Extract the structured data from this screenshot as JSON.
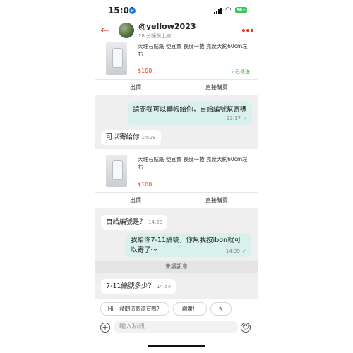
{
  "status_bar": {
    "time": "15:00",
    "battery": "86+"
  },
  "header": {
    "back": "←",
    "username": "@yellow2023",
    "last_seen": "28 分鐘前上線",
    "more": "⋯"
  },
  "product_card_1": {
    "title": "大理石貼紙 便宜賣 長度一捲 寬度大約60cm左右",
    "price": "$100",
    "status": "✓已傳送"
  },
  "card_actions_1": {
    "offer": "出價",
    "buy": "直接購買"
  },
  "messages": [
    {
      "text": "請問我可以轉帳給你，自給編號幫寄嗎",
      "time": "13:17",
      "check": "✓"
    },
    {
      "text": "可以寄給你",
      "time": "14:29"
    }
  ],
  "product_card_2": {
    "title": "大理石貼紙 便宜賣 長度一捲 寬度大約60cm左右",
    "price": "$100"
  },
  "card_actions_2": {
    "offer": "出價",
    "buy": "直接購買"
  },
  "messages_2": [
    {
      "text": "自給編號是？",
      "time": "14:29"
    },
    {
      "text": "我給你7-11編號，你幫我按ibon就可以寄了～",
      "time": "14:39",
      "check": "✓"
    }
  ],
  "unread_divider": "未讀訊息",
  "messages_3": [
    {
      "text": "7-11編號多少？",
      "time": "14:54"
    }
  ],
  "quick_replies": [
    "Hi~ 請問這個還有嗎？",
    "謝謝！"
  ],
  "quick_edit_icon": "✎",
  "composer": {
    "placeholder": "輸入私訊..."
  }
}
